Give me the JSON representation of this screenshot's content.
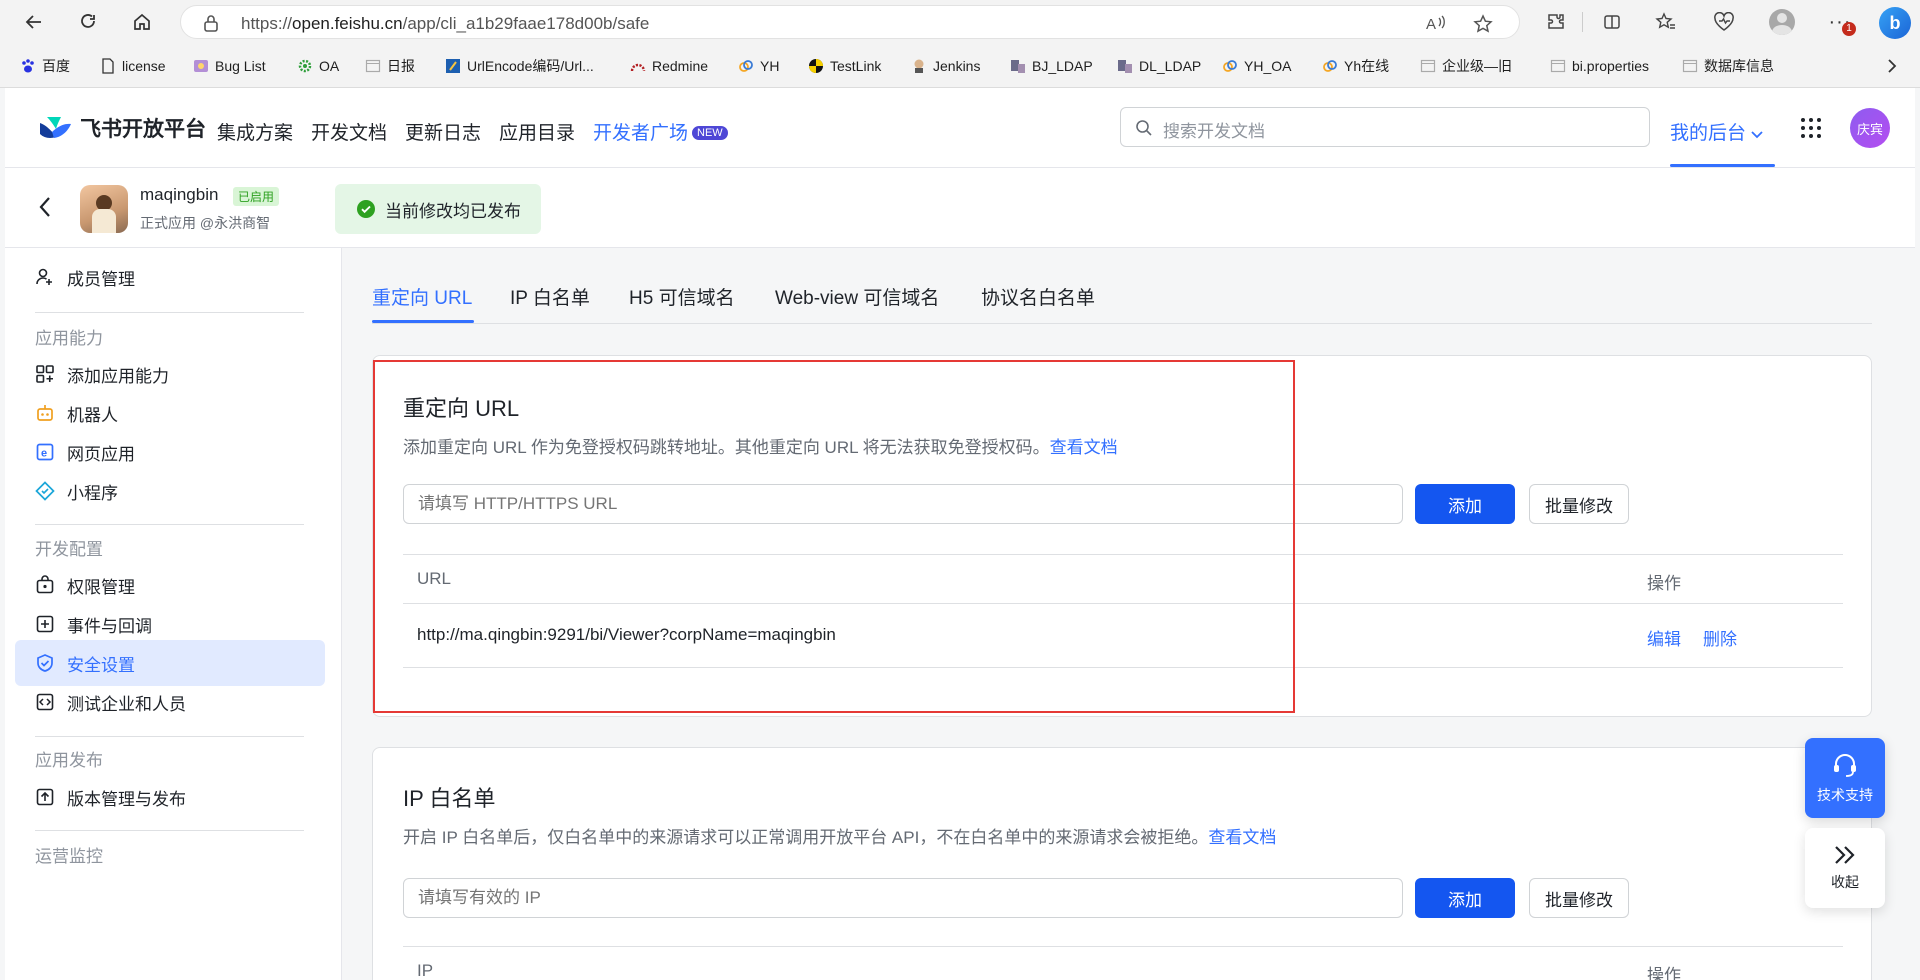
{
  "browser": {
    "url_prefix": "https://",
    "url_host": "open.feishu.cn",
    "url_path": "/app/cli_a1b29faae178d00b/safe",
    "bookmarks": [
      {
        "label": "百度",
        "icon": "paw-icon"
      },
      {
        "label": "license",
        "icon": "file-icon"
      },
      {
        "label": "Bug List",
        "icon": "bug-icon"
      },
      {
        "label": "OA",
        "icon": "gear-icon"
      },
      {
        "label": "日报",
        "icon": "page-icon"
      },
      {
        "label": "UrlEncode编码/Url...",
        "icon": "code-icon"
      },
      {
        "label": "Redmine",
        "icon": "redmine-icon"
      },
      {
        "label": "YH",
        "icon": "rings-icon"
      },
      {
        "label": "TestLink",
        "icon": "testlink-icon"
      },
      {
        "label": "Jenkins",
        "icon": "jenkins-icon"
      },
      {
        "label": "BJ_LDAP",
        "icon": "ldap-icon"
      },
      {
        "label": "DL_LDAP",
        "icon": "ldap-icon"
      },
      {
        "label": "YH_OA",
        "icon": "rings-icon"
      },
      {
        "label": "Yh在线",
        "icon": "rings-icon"
      },
      {
        "label": "企业级—旧",
        "icon": "page-icon"
      },
      {
        "label": "bi.properties",
        "icon": "page-icon"
      },
      {
        "label": "数据库信息",
        "icon": "page-icon"
      }
    ],
    "notification_count": "1"
  },
  "header": {
    "logo_text": "飞书开放平台",
    "nav": [
      "集成方案",
      "开发文档",
      "更新日志",
      "应用目录",
      "开发者广场"
    ],
    "new_badge": "NEW",
    "search_placeholder": "搜索开发文档",
    "my_backend": "我的后台",
    "user_initials": "庆宾"
  },
  "app": {
    "name": "maqingbin",
    "status": "已启用",
    "subtitle": "正式应用 @永洪商智",
    "publish_state": "当前修改均已发布"
  },
  "sidebar": {
    "top_item": "成员管理",
    "sections": [
      {
        "title": "应用能力",
        "items": [
          "添加应用能力",
          "机器人",
          "网页应用",
          "小程序"
        ]
      },
      {
        "title": "开发配置",
        "items": [
          "权限管理",
          "事件与回调",
          "安全设置",
          "测试企业和人员"
        ]
      },
      {
        "title": "应用发布",
        "items": [
          "版本管理与发布"
        ]
      },
      {
        "title": "运营监控",
        "items": []
      }
    ],
    "active_item": "安全设置"
  },
  "tabs": [
    "重定向 URL",
    "IP 白名单",
    "H5 可信域名",
    "Web-view 可信域名",
    "协议名白名单"
  ],
  "redirect_card": {
    "title": "重定向 URL",
    "desc": "添加重定向 URL 作为免登授权码跳转地址。其他重定向 URL 将无法获取免登授权码。",
    "doc_link": "查看文档",
    "input_placeholder": "请填写 HTTP/HTTPS URL",
    "add_label": "添加",
    "batch_label": "批量修改",
    "col_url": "URL",
    "col_action": "操作",
    "rows": [
      {
        "url": "http://ma.qingbin:9291/bi/Viewer?corpName=maqingbin",
        "edit": "编辑",
        "delete": "删除"
      }
    ]
  },
  "ip_card": {
    "title": "IP 白名单",
    "desc": "开启 IP 白名单后，仅白名单中的来源请求可以正常调用开放平台 API，不在白名单中的来源请求会被拒绝。",
    "doc_link": "查看文档",
    "input_placeholder": "请填写有效的 IP",
    "add_label": "添加",
    "batch_label": "批量修改",
    "col_ip": "IP",
    "col_action": "操作"
  },
  "floating": {
    "support": "技术支持",
    "collapse": "收起"
  },
  "colors": {
    "accent": "#3370ff",
    "primary_button": "#1456f0",
    "highlight": "#e53935"
  }
}
